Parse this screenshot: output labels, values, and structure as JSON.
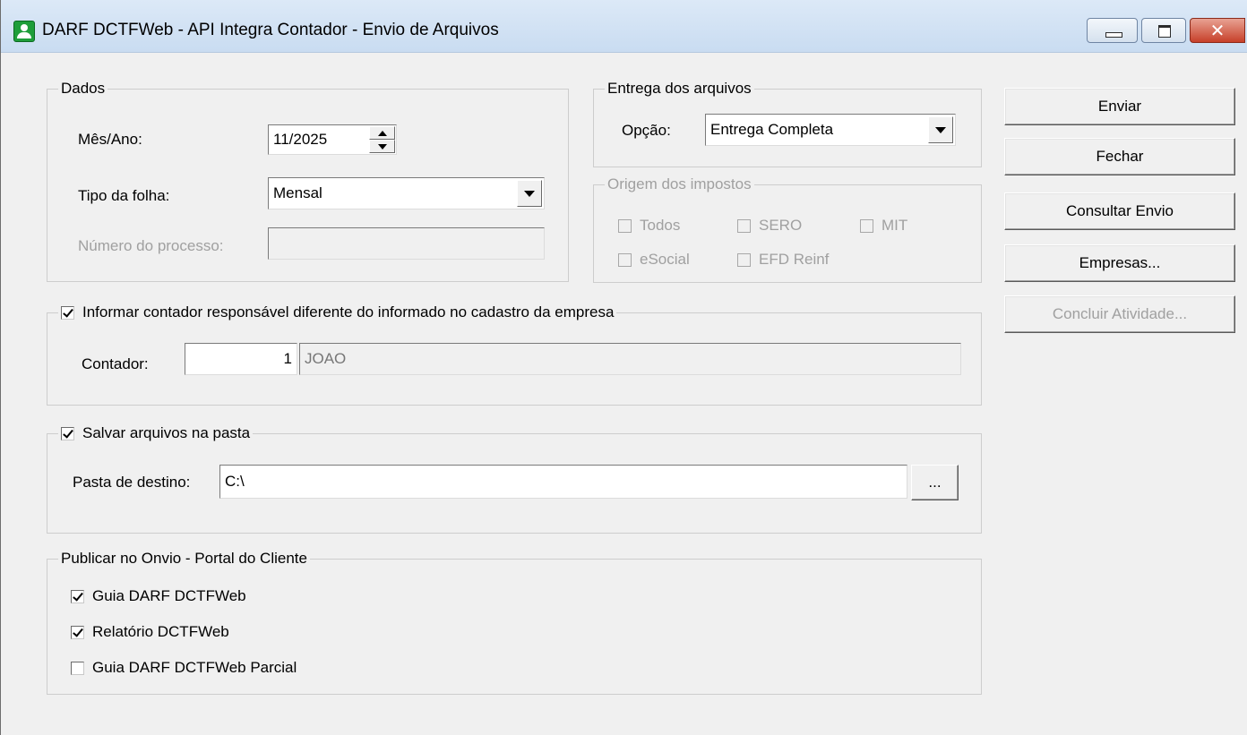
{
  "window": {
    "title": "DARF DCTFWeb - API Integra Contador - Envio de Arquivos",
    "close_glyph": "✕"
  },
  "dados": {
    "title": "Dados",
    "mes_ano_label": "Mês/Ano:",
    "mes_ano_value": "11/2025",
    "tipo_folha_label": "Tipo da folha:",
    "tipo_folha_value": "Mensal",
    "numero_processo_label": "Número do processo:",
    "numero_processo_value": ""
  },
  "entrega": {
    "title": "Entrega dos arquivos",
    "opcao_label": "Opção:",
    "opcao_value": "Entrega Completa"
  },
  "origem": {
    "title": "Origem dos impostos",
    "items": [
      {
        "label": "Todos",
        "checked": false
      },
      {
        "label": "SERO",
        "checked": false
      },
      {
        "label": "MIT",
        "checked": false
      },
      {
        "label": "eSocial",
        "checked": false
      },
      {
        "label": "EFD Reinf",
        "checked": false
      }
    ]
  },
  "contador": {
    "checkbox_label": "Informar contador responsável diferente do informado no cadastro da empresa",
    "checked": true,
    "label": "Contador:",
    "code": "1",
    "name": "JOAO"
  },
  "salvar": {
    "checkbox_label": "Salvar arquivos na pasta",
    "checked": true,
    "pasta_label": "Pasta de destino:",
    "pasta_value": "C:\\",
    "browse_label": "..."
  },
  "publicar": {
    "title": "Publicar no Onvio - Portal do Cliente",
    "items": [
      {
        "label": "Guia DARF DCTFWeb",
        "checked": true
      },
      {
        "label": "Relatório DCTFWeb",
        "checked": true
      },
      {
        "label": "Guia DARF DCTFWeb Parcial",
        "checked": false
      }
    ]
  },
  "buttons": {
    "enviar": "Enviar",
    "fechar": "Fechar",
    "consultar": "Consultar Envio",
    "empresas": "Empresas...",
    "concluir": "Concluir Atividade..."
  }
}
